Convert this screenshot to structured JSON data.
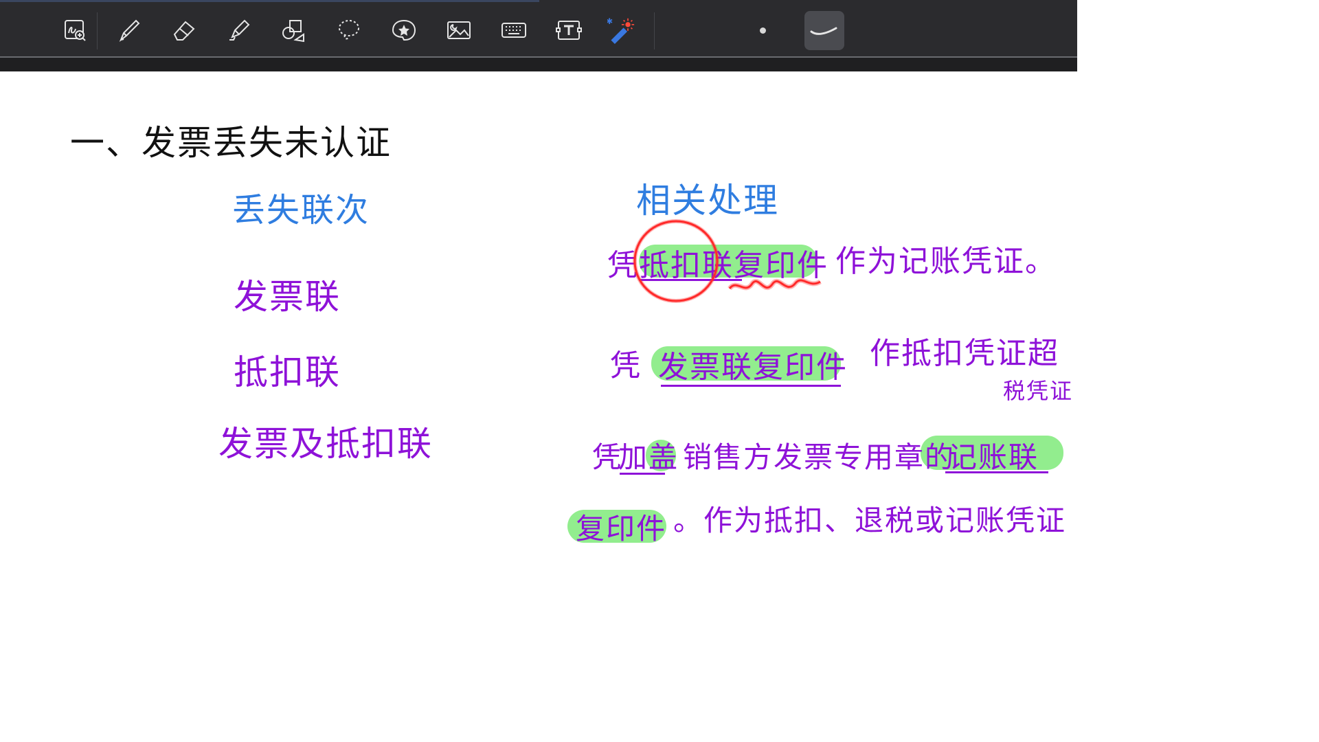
{
  "toolbar": {
    "tools": [
      {
        "name": "zoom-handwriting-icon"
      },
      {
        "name": "pen-icon"
      },
      {
        "name": "eraser-icon"
      },
      {
        "name": "highlighter-icon"
      },
      {
        "name": "shapes-icon"
      },
      {
        "name": "lasso-icon"
      },
      {
        "name": "sticker-icon"
      },
      {
        "name": "image-icon"
      },
      {
        "name": "keyboard-icon"
      },
      {
        "name": "text-box-icon"
      },
      {
        "name": "laser-pointer-icon"
      }
    ],
    "bluetooth_symbol": "✱",
    "colors": {
      "background": "#2b2b2e",
      "icon": "#e6e6e6",
      "laser": "#3a78e0",
      "laser_spark": "#ff4a3a"
    }
  },
  "notes": {
    "heading": "一、发票丢失未认证",
    "left": {
      "title": "丢失联次",
      "items": [
        "发票联",
        "抵扣联",
        "发票及抵扣联"
      ]
    },
    "right": {
      "title": "相关处理",
      "line1_prefix": "凭",
      "line1_highlight": "抵扣联复印件",
      "line1_suffix": "作为记账凭证。",
      "line2_prefix": "凭",
      "line2_highlight": "发票联复印件",
      "line2_suffix": "作抵扣凭证超",
      "line2_cont": "税凭证",
      "line3_prefix": "凭",
      "line3_stamp": "加盖",
      "line3_middle": "销售方发票专用章的",
      "line3_highlight": "记账联",
      "line4_highlight": "复印件",
      "line4_suffix": "。作为抵扣、退税或记账凭证"
    },
    "colors": {
      "black": "#111111",
      "blue": "#2f7de0",
      "purple": "#8e12d8",
      "highlight": "#7fea7a",
      "circle": "#ff2a2a"
    }
  }
}
